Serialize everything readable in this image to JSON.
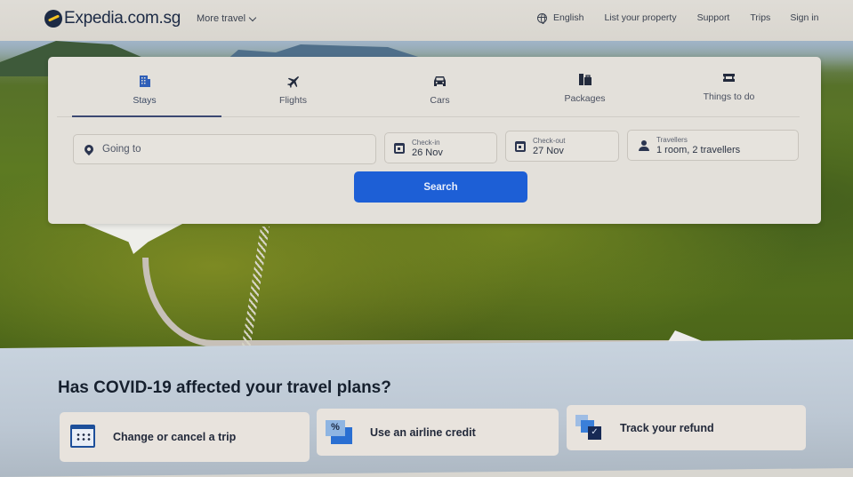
{
  "header": {
    "logo_text": "Expedia.com.sg",
    "more_travel": "More travel",
    "language": "English",
    "list_property": "List your property",
    "support": "Support",
    "trips": "Trips",
    "sign_in": "Sign in"
  },
  "search": {
    "tabs": [
      {
        "label": "Stays",
        "icon": "hotel-building-icon",
        "active": true
      },
      {
        "label": "Flights",
        "icon": "airplane-icon",
        "active": false
      },
      {
        "label": "Cars",
        "icon": "car-icon",
        "active": false
      },
      {
        "label": "Packages",
        "icon": "suitcase-icon",
        "active": false
      },
      {
        "label": "Things to do",
        "icon": "ticket-icon",
        "active": false
      }
    ],
    "destination_placeholder": "Going to",
    "check_in_label": "Check-in",
    "check_in_value": "26 Nov",
    "check_out_label": "Check-out",
    "check_out_value": "27 Nov",
    "travellers_label": "Travellers",
    "travellers_value": "1 room, 2 travellers",
    "search_button": "Search"
  },
  "covid": {
    "title": "Has COVID-19 affected your travel plans?",
    "cards": [
      {
        "label": "Change or cancel a trip",
        "icon": "calendar-icon"
      },
      {
        "label": "Use an airline credit",
        "icon": "percent-credit-icon"
      },
      {
        "label": "Track your refund",
        "icon": "refund-check-icon"
      }
    ],
    "percent_glyph": "%",
    "check_glyph": "✓"
  },
  "colors": {
    "brand_navy": "#1c2a45",
    "logo_accent": "#f4c223",
    "search_button": "#1d5fd6",
    "active_tab_underline": "#3b4872"
  }
}
